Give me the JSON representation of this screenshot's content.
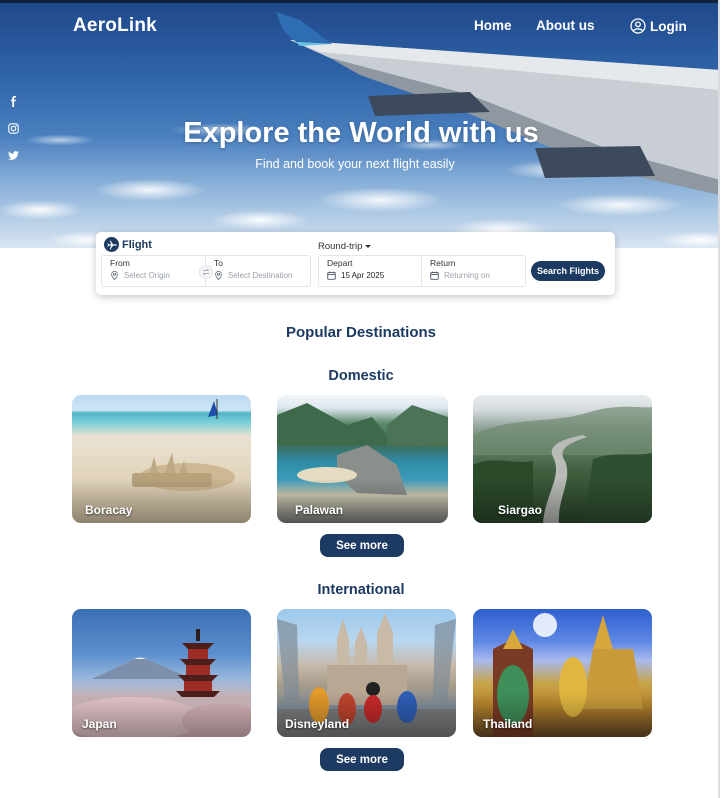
{
  "brand": {
    "name": "AeroLink"
  },
  "nav": {
    "home": "Home",
    "about": "About us",
    "login": "Login"
  },
  "social": [
    "facebook-icon",
    "instagram-icon",
    "twitter-icon"
  ],
  "hero": {
    "title": "Explore the World with us",
    "subtitle": "Find and book your next flight easily"
  },
  "search": {
    "tab": "Flight",
    "trip_type": "Round-trip",
    "from": {
      "label": "From",
      "placeholder": "Select Origin"
    },
    "to": {
      "label": "To",
      "placeholder": "Select Destination"
    },
    "depart": {
      "label": "Depart",
      "value": "15 Apr 2025"
    },
    "return": {
      "label": "Return",
      "placeholder": "Returning on"
    },
    "button": "Search Flights"
  },
  "sections": {
    "popular": "Popular Destinations",
    "domestic": {
      "title": "Domestic",
      "items": [
        "Boracay",
        "Palawan",
        "Siargao"
      ],
      "more": "See more"
    },
    "international": {
      "title": "International",
      "items": [
        "Japan",
        "Disneyland",
        "Thailand"
      ],
      "more": "See more"
    }
  },
  "colors": {
    "primary": "#1d3a63",
    "white": "#ffffff"
  }
}
